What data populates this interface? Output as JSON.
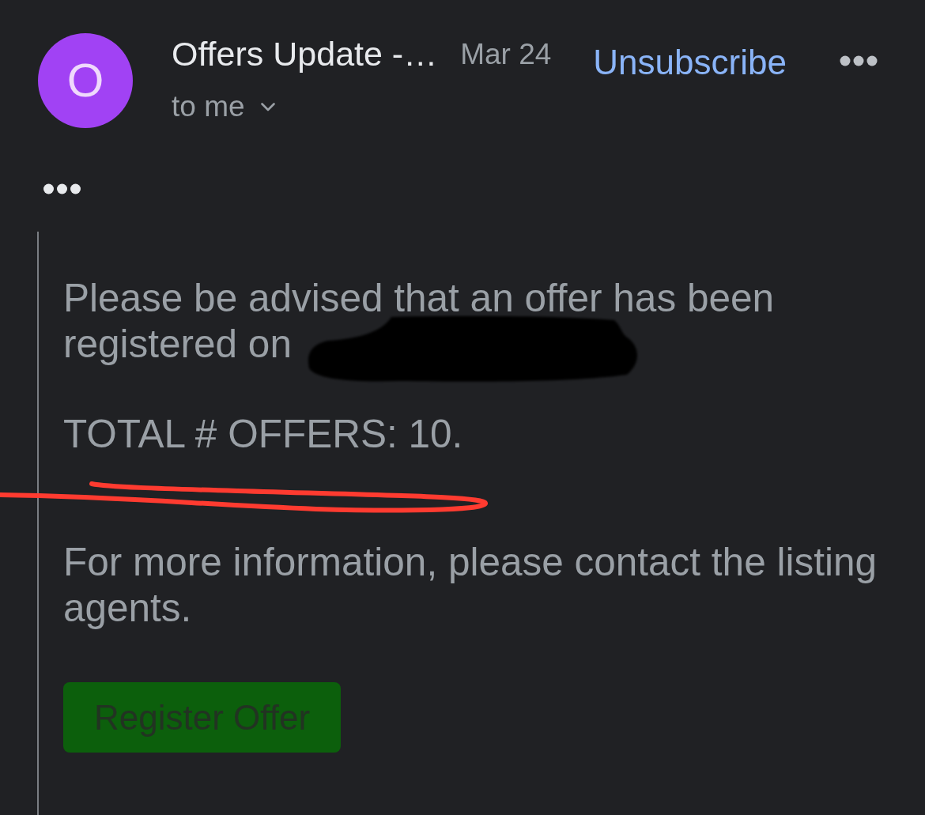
{
  "message_header": {
    "avatar_letter": "O",
    "sender": "Offers Update -…",
    "date": "Mar 24",
    "unsubscribe": "Unsubscribe",
    "recipient": "to me"
  },
  "body": {
    "paragraphs": [
      {
        "text": "Please be advised that an offer has been registered on",
        "redacted": true,
        "hand_underlined": false
      },
      {
        "text": "TOTAL # OFFERS: 10.",
        "redacted": false,
        "hand_underlined": true
      },
      {
        "text": "For more information, please contact the listing agents.",
        "redacted": false,
        "hand_underlined": false
      }
    ],
    "button": "Register Offer"
  }
}
